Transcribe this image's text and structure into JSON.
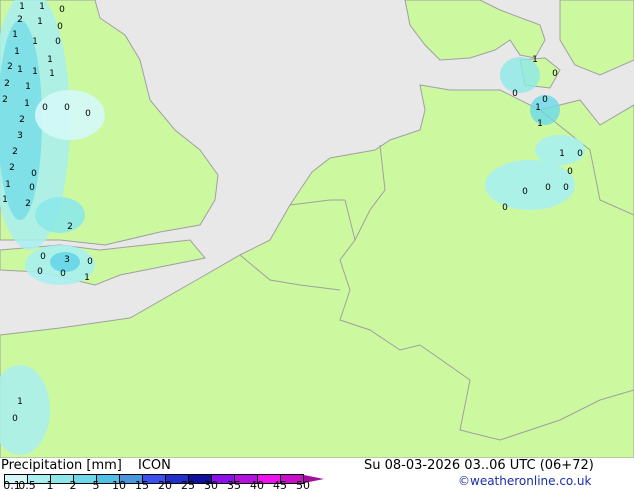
{
  "legend": {
    "title": "Precipitation [mm]",
    "model": "ICON",
    "datetime": "Su 08-03-2026 03..06 UTC (06+72)",
    "credit": "©weatheronline.co.uk",
    "ticks": [
      "0.1",
      "0.5",
      "1",
      "2",
      "5",
      "10",
      "15",
      "20",
      "25",
      "30",
      "35",
      "40",
      "45",
      "50"
    ],
    "colors": [
      "#d4f8f8",
      "#a8f0f0",
      "#8ce8e8",
      "#6cd8e8",
      "#50c0e8",
      "#4898e0",
      "#3c50f0",
      "#2030c8",
      "#10109c",
      "#8c10e8",
      "#b410e0",
      "#f010f0",
      "#c810c8"
    ],
    "arrow_color": "#a0109c"
  },
  "map": {
    "land_color": "#ccf8a0",
    "sea_color": "#e8e8e8",
    "border_color": "#a0a0a0",
    "precip_labels": [
      "1",
      "1",
      "2",
      "1",
      "1",
      "0",
      "0",
      "1",
      "1",
      "0",
      "1",
      "1",
      "1",
      "2",
      "1",
      "2",
      "1",
      "2",
      "1",
      "0",
      "0",
      "0",
      "2",
      "3",
      "2",
      "2",
      "0",
      "1",
      "0",
      "1",
      "2",
      "2",
      "0",
      "3",
      "0",
      "0",
      "1",
      "0",
      "1",
      "0",
      "0",
      "1",
      "0",
      "1",
      "1",
      "0",
      "0",
      "0",
      "0",
      "0",
      "0",
      "1",
      "0"
    ]
  }
}
